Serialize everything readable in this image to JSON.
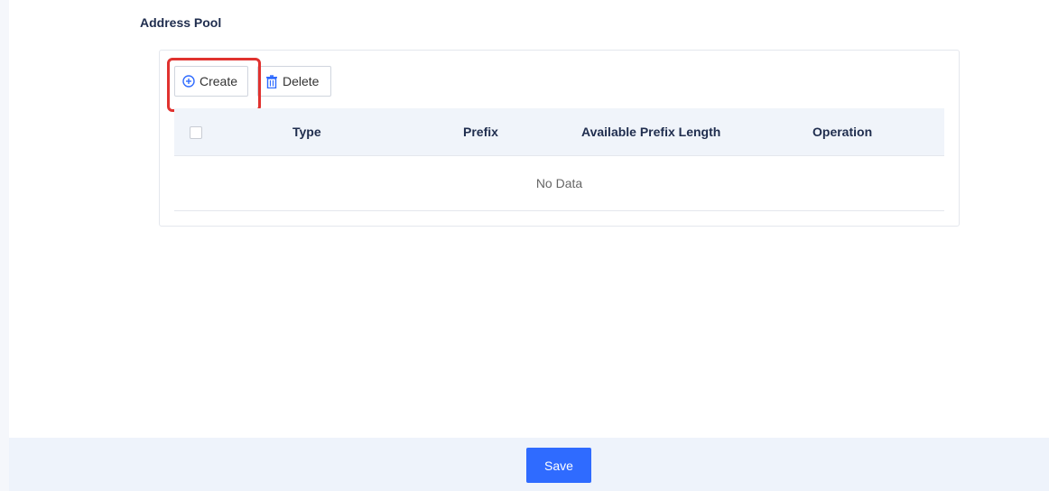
{
  "section": {
    "title": "Address Pool"
  },
  "toolbar": {
    "create_label": "Create",
    "delete_label": "Delete"
  },
  "table": {
    "columns": [
      "Type",
      "Prefix",
      "Available Prefix Length",
      "Operation"
    ],
    "empty_text": "No Data"
  },
  "footer": {
    "save_label": "Save"
  },
  "icons": {
    "create": "plus-circle-icon",
    "delete": "trash-icon"
  },
  "colors": {
    "accent": "#2f6bff",
    "highlight": "#e0322f"
  }
}
